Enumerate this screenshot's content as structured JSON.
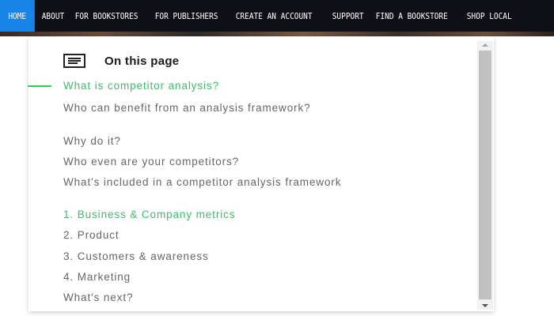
{
  "nav": {
    "items": [
      {
        "label": "HOME",
        "active": true
      },
      {
        "label": "ABOUT"
      },
      {
        "label": "FOR BOOKSTORES"
      },
      {
        "label": "FOR PUBLISHERS"
      },
      {
        "label": "CREATE AN ACCOUNT"
      },
      {
        "label": "SUPPORT"
      },
      {
        "label": "FIND A BOOKSTORE"
      },
      {
        "label": "SHOP LOCAL"
      }
    ]
  },
  "toc": {
    "icon": "table-of-contents-icon",
    "title": "On this page",
    "items": [
      {
        "label": "What is competitor analysis?",
        "current": true
      },
      {
        "label": "Who can benefit from an analysis framework?"
      },
      {
        "label": "Why do it?"
      },
      {
        "label": "Who even are your competitors?"
      },
      {
        "label": "What's included in a competitor analysis framework"
      },
      {
        "label": "1. Business & Company metrics",
        "current": true
      },
      {
        "label": "2. Product"
      },
      {
        "label": "3. Customers & awareness"
      },
      {
        "label": "4. Marketing"
      },
      {
        "label": "What's next?"
      }
    ]
  },
  "colors": {
    "nav_bg": "#101018",
    "nav_active": "#1a84e6",
    "accent_green": "#3dbb6a",
    "text_gray": "#666666"
  }
}
